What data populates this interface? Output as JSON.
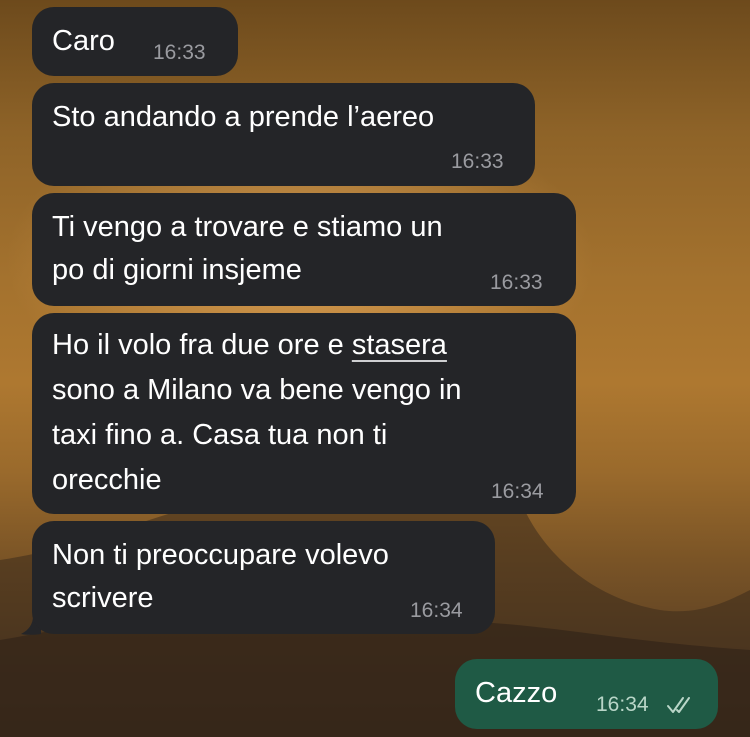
{
  "messages": [
    {
      "text": "Caro",
      "time": "16:33"
    },
    {
      "text": "Sto andando a prende l’aereo",
      "time": "16:33"
    },
    {
      "lines": [
        "Ti vengo a trovare e stiamo un",
        "po di giorni insjeme"
      ],
      "time": "16:33"
    },
    {
      "line1_pre": "Ho il volo fra due ore e ",
      "line1_link": "stasera",
      "lines_rest": [
        "sono a Milano va bene vengo in",
        "taxi fino a. Casa tua non ti",
        "orecchie"
      ],
      "time": "16:34"
    },
    {
      "lines": [
        "Non ti preoccupare volevo",
        "scrivere"
      ],
      "time": "16:34"
    },
    {
      "text": "Cazzo",
      "time": "16:34",
      "status_icon": "read-double-check-icon"
    }
  ],
  "colors": {
    "incoming_bubble": "#242528",
    "outgoing_bubble": "#1f5a45",
    "text": "#ffffff",
    "timestamp": "#9a9ba0"
  }
}
